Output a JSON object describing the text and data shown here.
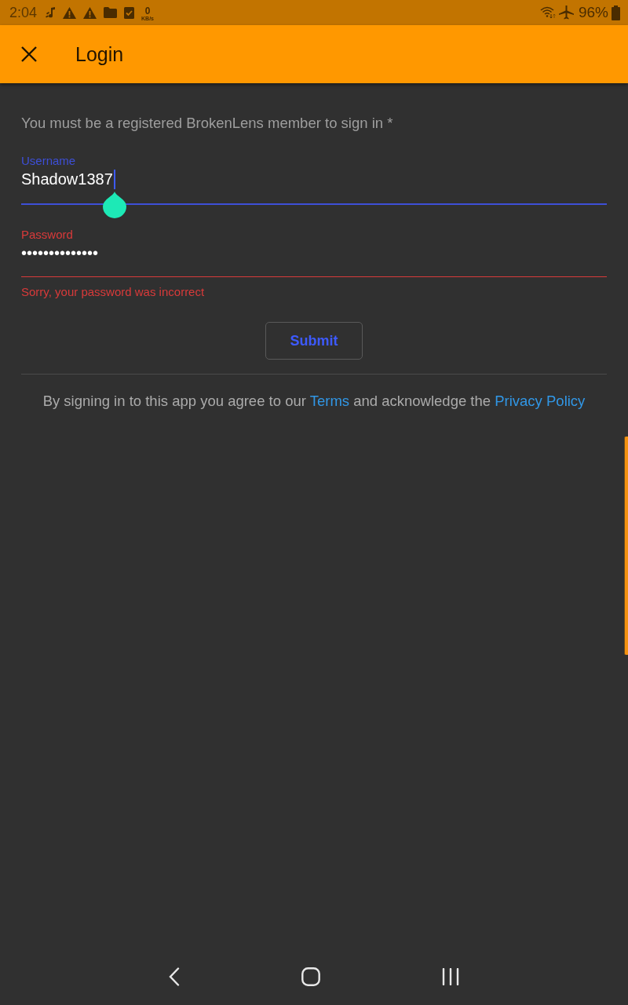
{
  "status_bar": {
    "time": "2:04",
    "data_rate": {
      "value": "0",
      "unit": "KB/s"
    },
    "battery": "96%"
  },
  "app_bar": {
    "title": "Login"
  },
  "notice": "You must be a registered BrokenLens member to sign in *",
  "fields": [
    {
      "label": "Username",
      "value": "Shadow1387",
      "focused": true,
      "invalid": false
    },
    {
      "label": "Password",
      "value": "••••••••••••••",
      "focused": false,
      "invalid": true,
      "error": "Sorry, your password was incorrect"
    }
  ],
  "submit_button": "Submit",
  "footer": [
    {
      "kind": "text",
      "text": "By signing in to this app you agree to our "
    },
    {
      "kind": "link",
      "text": "Terms"
    },
    {
      "kind": "text",
      "text": " and acknowledge the "
    },
    {
      "kind": "link",
      "text": "Privacy Policy"
    }
  ]
}
